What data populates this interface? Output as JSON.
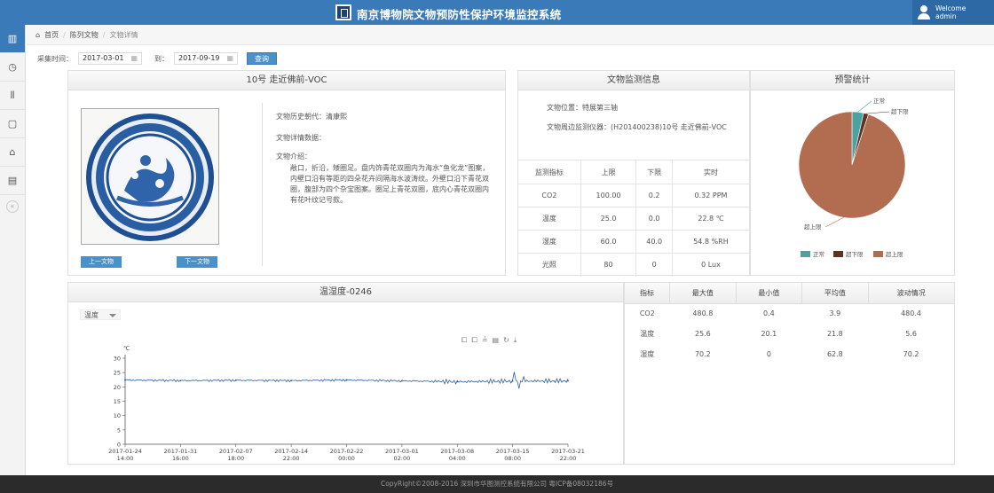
{
  "header": {
    "title": "南京博物院文物预防性保护环境监控系统",
    "welcome": "Welcome",
    "user": "admin"
  },
  "sidebar": {
    "icons": [
      "monitor-icon",
      "clock-icon",
      "bars-icon",
      "document-icon",
      "tools-icon",
      "box-icon"
    ]
  },
  "breadcrumb": {
    "home": "首页",
    "list": "陈列文物",
    "current": "文物详情"
  },
  "filter": {
    "label": "采集时间：",
    "start": "2017-03-01",
    "to": "到：",
    "end": "2017-09-19",
    "query": "查询"
  },
  "artifact": {
    "title": "10号 走近佛前-VOC",
    "era_label": "文物历史朝代：",
    "era_value": "清康熙",
    "detail_label": "文物详情数据：",
    "intro_label": "文物介绍：",
    "intro_text": "敞口，折沿，矮圈足。盘内饰青花双圈内为海水“鱼化龙”图案，内壁口沿有等距的四朵花卉间隔海水波涛纹。外壁口沿下青花双圈，腹部为四个杂宝图案。圈足上青花双圈，底内心青花双圈内有花叶纹记号款。",
    "prev": "上一文物",
    "next": "下一文物"
  },
  "info": {
    "title": "文物监测信息",
    "location": "文物位置：特展第三轴",
    "instrument": "文物周边监测仪器：(H201400238)10号 走近佛前-VOC",
    "headers": [
      "监测指标",
      "上限",
      "下限",
      "实时"
    ],
    "rows": [
      [
        "CO2",
        "100.00",
        "0.2",
        "0.32 PPM"
      ],
      [
        "温度",
        "25.0",
        "0.0",
        "22.8 ℃"
      ],
      [
        "湿度",
        "60.0",
        "40.0",
        "54.8 %RH"
      ],
      [
        "光照",
        "80",
        "0",
        "0 Lux"
      ]
    ]
  },
  "warn": {
    "title": "预警统计",
    "slices": [
      {
        "label": "正常",
        "value": 3.5,
        "color": "#4aa3a0"
      },
      {
        "label": "超下限",
        "value": 1.5,
        "color": "#5e3324"
      },
      {
        "label": "超上限",
        "value": 95,
        "color": "#b26c50"
      }
    ],
    "legend": [
      "正常",
      "超下限",
      "超上限"
    ]
  },
  "chart": {
    "title": "温湿度-0246",
    "select": "温度",
    "unit": "℃",
    "tools": [
      "⧠",
      "⧠",
      "≟",
      "▤",
      "↻",
      "⤓"
    ],
    "yticks": [
      "30",
      "25",
      "20",
      "15",
      "10",
      "5",
      "0"
    ],
    "xticks": [
      [
        "2017-01-24",
        "14:00"
      ],
      [
        "2017-01-31",
        "16:00"
      ],
      [
        "2017-02-07",
        "18:00"
      ],
      [
        "2017-02-14",
        "22:00"
      ],
      [
        "2017-02-22",
        "00:00"
      ],
      [
        "2017-03-01",
        "02:00"
      ],
      [
        "2017-03-08",
        "04:00"
      ],
      [
        "2017-03-15",
        "08:00"
      ],
      [
        "2017-03-21",
        "22:00"
      ]
    ]
  },
  "stats": {
    "headers": [
      "指标",
      "最大值",
      "最小值",
      "平均值",
      "波动情况"
    ],
    "rows": [
      [
        "CO2",
        "480.8",
        "0.4",
        "3.9",
        "480.4"
      ],
      [
        "温度",
        "25.6",
        "20.1",
        "21.8",
        "5.6"
      ],
      [
        "湿度",
        "70.2",
        "0",
        "62.8",
        "70.2"
      ]
    ]
  },
  "footer": "CopyRight©2008-2016 深圳市华图测控系统有限公司 粤ICP备08032186号",
  "chart_data": {
    "type": "line",
    "title": "温湿度-0246",
    "ylabel": "℃",
    "ylim": [
      0,
      30
    ],
    "x": [
      "2017-01-24 14:00",
      "2017-01-31 16:00",
      "2017-02-07 18:00",
      "2017-02-14 22:00",
      "2017-02-22 00:00",
      "2017-03-01 02:00",
      "2017-03-08 04:00",
      "2017-03-15 08:00",
      "2017-03-21 22:00"
    ],
    "series": [
      {
        "values": [
          22.4,
          22.2,
          22.3,
          22.2,
          22.4,
          22.1,
          21.8,
          22.0,
          22.1
        ]
      }
    ],
    "grid": false
  }
}
